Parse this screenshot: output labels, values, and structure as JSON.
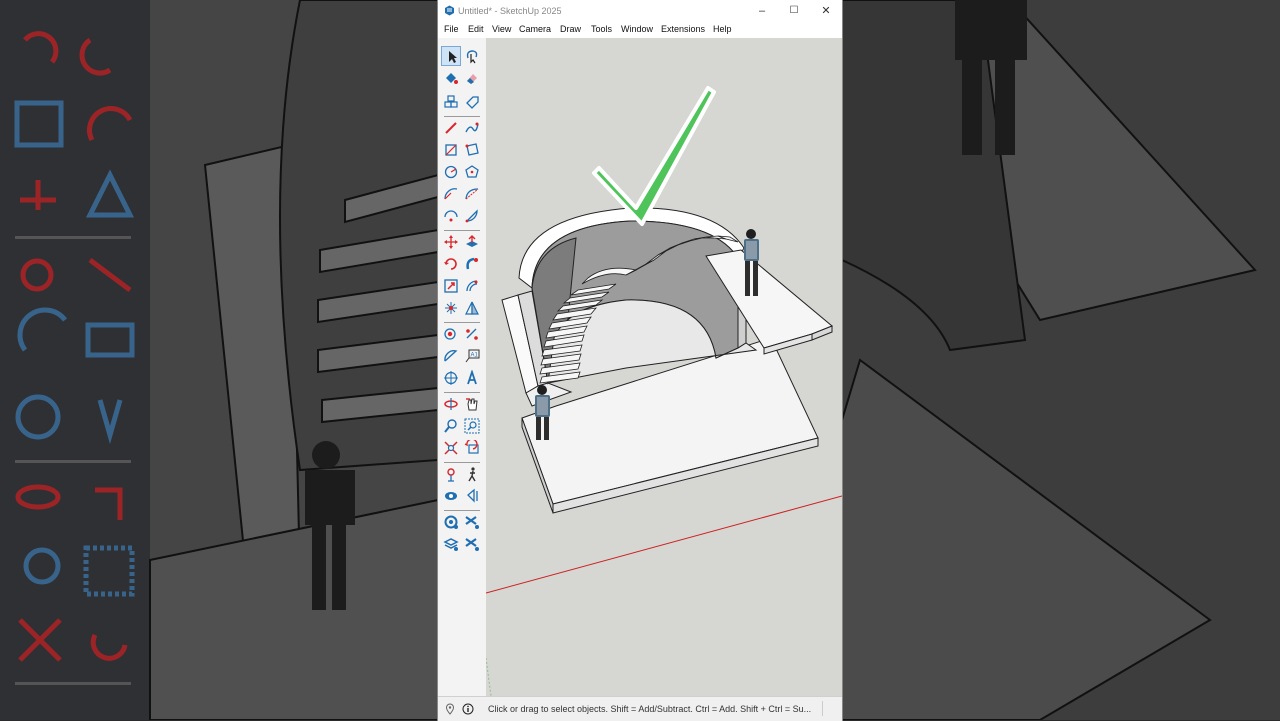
{
  "window": {
    "title": "Untitled* - SketchUp 2025",
    "controls": {
      "minimize": "–",
      "maximize": "☐",
      "close": "✕"
    }
  },
  "menu": [
    "File",
    "Edit",
    "View",
    "Camera",
    "Draw",
    "Tools",
    "Window",
    "Extensions",
    "Help"
  ],
  "tools": [
    "select-icon",
    "lasso-select-icon",
    "paint-bucket-icon",
    "eraser-icon",
    "component-icon",
    "tag-icon",
    "line-icon",
    "freehand-icon",
    "rectangle-icon",
    "rotated-rectangle-icon",
    "circle-icon",
    "polygon-icon",
    "arc-icon",
    "two-point-arc-icon",
    "three-point-arc-icon",
    "pie-icon",
    "move-icon",
    "push-pull-icon",
    "rotate-icon",
    "follow-me-icon",
    "scale-icon",
    "offset-icon",
    "solid-tools-icon",
    "flip-icon",
    "tape-measure-icon",
    "dimension-icon",
    "protractor-icon",
    "text-icon",
    "axes-icon",
    "3d-text-icon",
    "orbit-icon",
    "pan-icon",
    "zoom-icon",
    "zoom-window-icon",
    "zoom-extents-icon",
    "previous-view-icon",
    "position-camera-icon",
    "walk-icon",
    "look-around-icon",
    "section-plane-icon",
    "layout-icon",
    "styles-icon",
    "scenes-icon",
    "tags-panel-icon"
  ],
  "status": {
    "hint": "Click or drag to select objects. Shift = Add/Subtract. Ctrl = Add. Shift + Ctrl = Su..."
  },
  "colors": {
    "accent": "#1f6fb2",
    "tool_red": "#d9262b",
    "check_green": "#4fc45a",
    "axis_red": "#cc2020"
  }
}
